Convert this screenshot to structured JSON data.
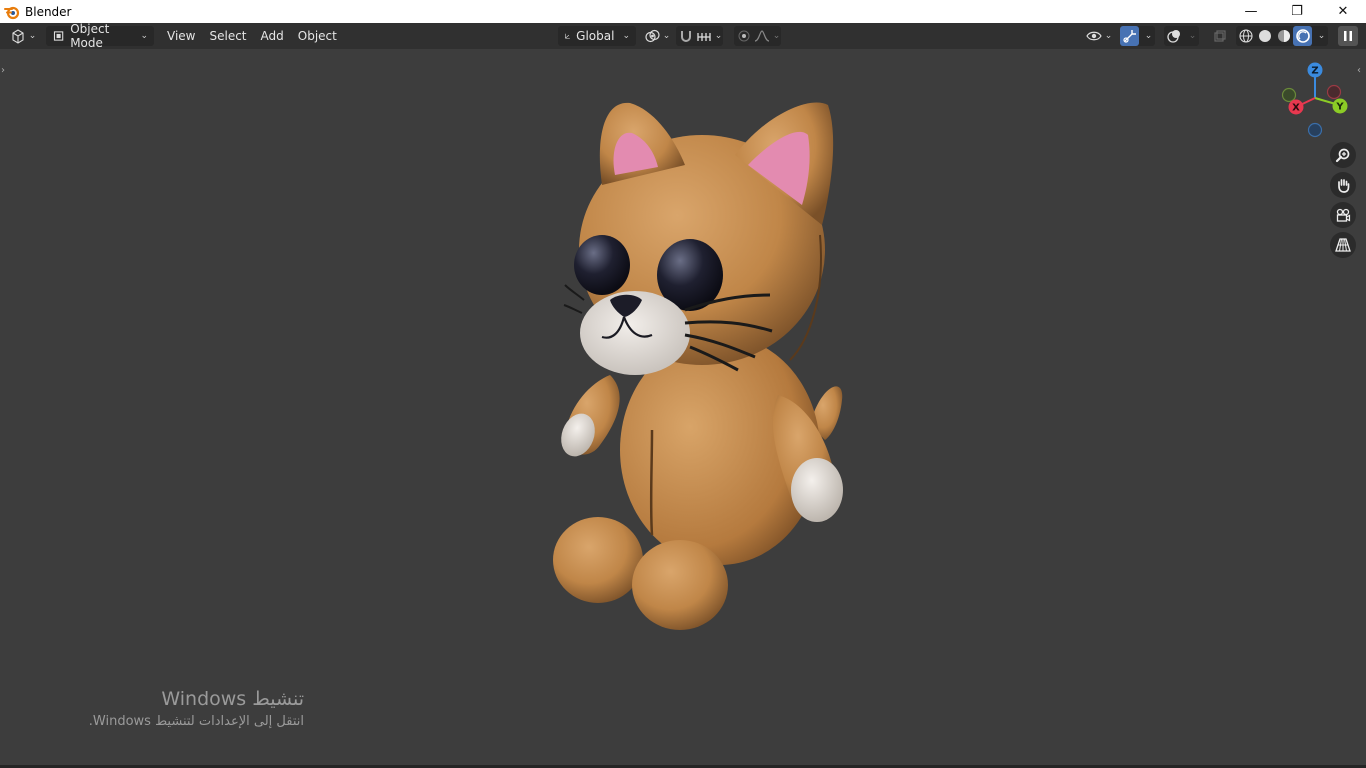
{
  "window": {
    "title": "Blender",
    "controls": {
      "minimize": "—",
      "restore": "❐",
      "close": "✕"
    }
  },
  "header": {
    "mode_label": "Object Mode",
    "menus": [
      "View",
      "Select",
      "Add",
      "Object"
    ],
    "transform_orientation": "Global"
  },
  "viewport": {
    "gizmo_axes": {
      "z": "Z",
      "y": "Y",
      "x": "X"
    },
    "colors": {
      "x": "#e8384f",
      "y": "#8ccc26",
      "z": "#3b8bdf",
      "background": "#3d3d3d"
    }
  },
  "watermark": {
    "title": "تنشيط Windows",
    "subtitle": "انتقل إلى الإعدادات لتنشيط Windows."
  }
}
